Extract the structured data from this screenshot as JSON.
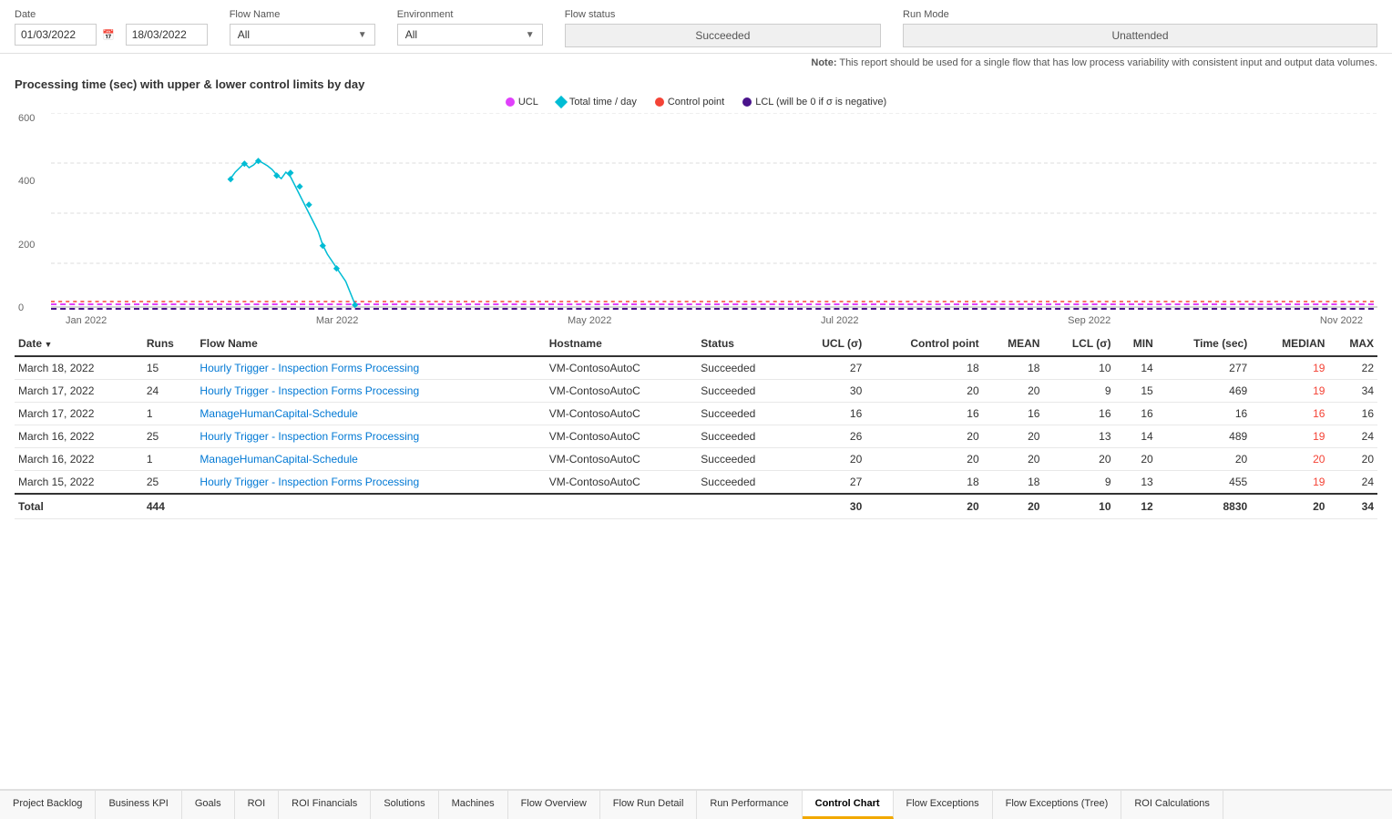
{
  "filters": {
    "date_label": "Date",
    "date_from": "01/03/2022",
    "date_to": "18/03/2022",
    "flowname_label": "Flow Name",
    "flowname_value": "All",
    "environment_label": "Environment",
    "environment_value": "All",
    "flow_status_label": "Flow status",
    "flow_status_value": "Succeeded",
    "run_mode_label": "Run Mode",
    "run_mode_value": "Unattended"
  },
  "note": "Note:",
  "note_text": " This report should be used for a single flow that has low process variability with consistent input and output data volumes.",
  "chart_title": "Processing time (sec) with upper & lower control limits by day",
  "legend": [
    {
      "label": "UCL",
      "color": "#e040fb",
      "type": "dot"
    },
    {
      "label": "Total time / day",
      "color": "#00bcd4",
      "type": "diamond"
    },
    {
      "label": "Control point",
      "color": "#f44336",
      "type": "dot"
    },
    {
      "label": "LCL (will be 0 if σ is negative)",
      "color": "#4a148c",
      "type": "dot"
    }
  ],
  "y_labels": [
    "600",
    "400",
    "200",
    "0"
  ],
  "x_labels": [
    "Jan 2022",
    "Mar 2022",
    "May 2022",
    "Jul 2022",
    "Sep 2022",
    "Nov 2022"
  ],
  "table_headers": [
    "Date",
    "Runs",
    "Flow Name",
    "Hostname",
    "Status",
    "UCL (σ)",
    "Control point",
    "MEAN",
    "LCL (σ)",
    "MIN",
    "Time (sec)",
    "MEDIAN",
    "MAX"
  ],
  "table_rows": [
    {
      "date": "March 18, 2022",
      "runs": "15",
      "flow_name": "Hourly Trigger - Inspection Forms Processing",
      "hostname": "VM-ContosoAutoC",
      "status": "Succeeded",
      "ucl": "27",
      "control_point": "18",
      "mean": "18",
      "lcl": "10",
      "min": "14",
      "time_sec": "277",
      "median": "19",
      "max": "22"
    },
    {
      "date": "March 17, 2022",
      "runs": "24",
      "flow_name": "Hourly Trigger - Inspection Forms Processing",
      "hostname": "VM-ContosoAutoC",
      "status": "Succeeded",
      "ucl": "30",
      "control_point": "20",
      "mean": "20",
      "lcl": "9",
      "min": "15",
      "time_sec": "469",
      "median": "19",
      "max": "34"
    },
    {
      "date": "March 17, 2022",
      "runs": "1",
      "flow_name": "ManageHumanCapital-Schedule",
      "hostname": "VM-ContosoAutoC",
      "status": "Succeeded",
      "ucl": "16",
      "control_point": "16",
      "mean": "16",
      "lcl": "16",
      "min": "16",
      "time_sec": "16",
      "median": "16",
      "max": "16"
    },
    {
      "date": "March 16, 2022",
      "runs": "25",
      "flow_name": "Hourly Trigger - Inspection Forms Processing",
      "hostname": "VM-ContosoAutoC",
      "status": "Succeeded",
      "ucl": "26",
      "control_point": "20",
      "mean": "20",
      "lcl": "13",
      "min": "14",
      "time_sec": "489",
      "median": "19",
      "max": "24"
    },
    {
      "date": "March 16, 2022",
      "runs": "1",
      "flow_name": "ManageHumanCapital-Schedule",
      "hostname": "VM-ContosoAutoC",
      "status": "Succeeded",
      "ucl": "20",
      "control_point": "20",
      "mean": "20",
      "lcl": "20",
      "min": "20",
      "time_sec": "20",
      "median": "20",
      "max": "20"
    },
    {
      "date": "March 15, 2022",
      "runs": "25",
      "flow_name": "Hourly Trigger - Inspection Forms Processing",
      "hostname": "VM-ContosoAutoC",
      "status": "Succeeded",
      "ucl": "27",
      "control_point": "18",
      "mean": "18",
      "lcl": "9",
      "min": "13",
      "time_sec": "455",
      "median": "19",
      "max": "24"
    }
  ],
  "total_row": {
    "label": "Total",
    "runs": "444",
    "ucl": "30",
    "control_point": "20",
    "mean": "20",
    "lcl": "10",
    "min": "12",
    "time_sec": "8830",
    "median": "20",
    "max": "34"
  },
  "tabs": [
    {
      "label": "Project Backlog",
      "active": false
    },
    {
      "label": "Business KPI",
      "active": false
    },
    {
      "label": "Goals",
      "active": false
    },
    {
      "label": "ROI",
      "active": false
    },
    {
      "label": "ROI Financials",
      "active": false
    },
    {
      "label": "Solutions",
      "active": false
    },
    {
      "label": "Machines",
      "active": false
    },
    {
      "label": "Flow Overview",
      "active": false
    },
    {
      "label": "Flow Run Detail",
      "active": false
    },
    {
      "label": "Run Performance",
      "active": false
    },
    {
      "label": "Control Chart",
      "active": true
    },
    {
      "label": "Flow Exceptions",
      "active": false
    },
    {
      "label": "Flow Exceptions (Tree)",
      "active": false
    },
    {
      "label": "ROI Calculations",
      "active": false
    }
  ]
}
